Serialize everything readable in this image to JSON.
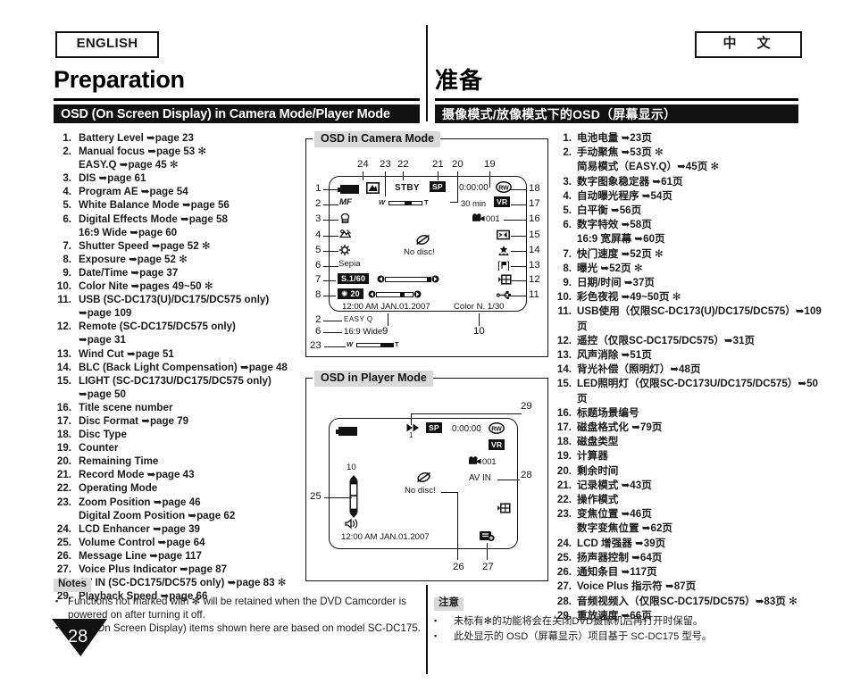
{
  "languages": {
    "english": "ENGLISH",
    "chinese": "中　文"
  },
  "chapter": {
    "en": "Preparation",
    "zh": "准备"
  },
  "section": {
    "en": "OSD (On Screen Display) in Camera Mode/Player Mode",
    "zh": "摄像模式/放像模式下的OSD（屏幕显示）"
  },
  "list_en": [
    {
      "num": "1.",
      "text": "Battery Level ➥page 23"
    },
    {
      "num": "2.",
      "text": "Manual focus ➥page 53 ✻",
      "sub": "EASY.Q ➥page 45 ✻"
    },
    {
      "num": "3.",
      "text": "DIS ➥page 61"
    },
    {
      "num": "4.",
      "text": "Program AE ➥page 54"
    },
    {
      "num": "5.",
      "text": "White Balance Mode ➥page 56"
    },
    {
      "num": "6.",
      "text": "Digital Effects Mode ➥page 58",
      "sub": "16:9 Wide ➥page 60"
    },
    {
      "num": "7.",
      "text": "Shutter Speed ➥page 52 ✻"
    },
    {
      "num": "8.",
      "text": "Exposure ➥page 52 ✻"
    },
    {
      "num": "9.",
      "text": "Date/Time ➥page 37"
    },
    {
      "num": "10.",
      "text": "Color Nite ➥pages 49~50 ✻"
    },
    {
      "num": "11.",
      "text": "USB (SC-DC173(U)/DC175/DC575 only)",
      "sub": "➥page 109"
    },
    {
      "num": "12.",
      "text": "Remote (SC-DC175/DC575 only)",
      "sub": "➥page 31"
    },
    {
      "num": "13.",
      "text": "Wind Cut ➥page 51"
    },
    {
      "num": "14.",
      "text": "BLC (Back Light Compensation) ➥page 48"
    },
    {
      "num": "15.",
      "text": "LIGHT (SC-DC173U/DC175/DC575 only)",
      "sub": "➥page 50"
    },
    {
      "num": "16.",
      "text": "Title scene number"
    },
    {
      "num": "17.",
      "text": "Disc Format ➥page 79"
    },
    {
      "num": "18.",
      "text": "Disc Type"
    },
    {
      "num": "19.",
      "text": "Counter"
    },
    {
      "num": "20.",
      "text": "Remaining Time"
    },
    {
      "num": "21.",
      "text": "Record Mode ➥page 43"
    },
    {
      "num": "22.",
      "text": "Operating Mode"
    },
    {
      "num": "23.",
      "text": "Zoom Position ➥page 46",
      "sub": "Digital Zoom Position ➥page 62"
    },
    {
      "num": "24.",
      "text": "LCD Enhancer ➥page 39"
    },
    {
      "num": "25.",
      "text": "Volume Control ➥page 64"
    },
    {
      "num": "26.",
      "text": "Message Line ➥page 117"
    },
    {
      "num": "27.",
      "text": "Voice Plus Indicator ➥page 87"
    },
    {
      "num": "28.",
      "text": "AV IN (SC-DC175/DC575 only) ➥page 83 ✻"
    },
    {
      "num": "29.",
      "text": "Playback Speed ➥page 66"
    }
  ],
  "list_zh": [
    {
      "num": "1.",
      "text": "电池电量 ➥23页"
    },
    {
      "num": "2.",
      "text": "手动聚焦 ➥53页 ✻",
      "sub": "简易模式（EASY.Q）➥45页 ✻"
    },
    {
      "num": "3.",
      "text": "数字图象稳定器 ➥61页"
    },
    {
      "num": "4.",
      "text": "自动曝光程序 ➥54页"
    },
    {
      "num": "5.",
      "text": "白平衡 ➥56页"
    },
    {
      "num": "6.",
      "text": "数字特效 ➥58页",
      "sub": "16:9 宽屏幕 ➥60页"
    },
    {
      "num": "7.",
      "text": "快门速度 ➥52页 ✻"
    },
    {
      "num": "8.",
      "text": "曝光 ➥52页 ✻"
    },
    {
      "num": "9.",
      "text": "日期/时间 ➥37页"
    },
    {
      "num": "10.",
      "text": "彩色夜视 ➥49~50页 ✻"
    },
    {
      "num": "11.",
      "text": "USB使用（仅限SC-DC173(U)/DC175/DC575）➥109页"
    },
    {
      "num": "12.",
      "text": "遥控（仅限SC-DC175/DC575）➥31页"
    },
    {
      "num": "13.",
      "text": "风声消除 ➥51页"
    },
    {
      "num": "14.",
      "text": "背光补偿（照明灯）➥48页"
    },
    {
      "num": "15.",
      "text": "LED照明灯（仅限SC-DC173U/DC175/DC575）➥50页"
    },
    {
      "num": "16.",
      "text": "标题场景编号"
    },
    {
      "num": "17.",
      "text": "磁盘格式化 ➥79页"
    },
    {
      "num": "18.",
      "text": "磁盘类型"
    },
    {
      "num": "19.",
      "text": "计算器"
    },
    {
      "num": "20.",
      "text": "剩余时间"
    },
    {
      "num": "21.",
      "text": "记录模式 ➥43页"
    },
    {
      "num": "22.",
      "text": "操作模式"
    },
    {
      "num": "23.",
      "text": "变焦位置 ➥46页",
      "sub": "数字变焦位置 ➥62页"
    },
    {
      "num": "24.",
      "text": "LCD 增强器 ➥39页"
    },
    {
      "num": "25.",
      "text": "扬声器控制 ➥64页"
    },
    {
      "num": "26.",
      "text": "通知条目 ➥117页"
    },
    {
      "num": "27.",
      "text": "Voice Plus 指示符 ➥87页"
    },
    {
      "num": "28.",
      "text": "音频视频入（仅限SC-DC175/DC575）➥83页 ✻"
    },
    {
      "num": "29.",
      "text": "重放速度 ➥66页"
    }
  ],
  "fig_camera": {
    "label": "OSD in Camera Mode",
    "osd": {
      "standby": "STBY",
      "record_mode": "SP",
      "counter": "0:00:00",
      "disc_type": "RW",
      "remaining": "30 min",
      "disc_format": "VR",
      "scene_number": "001",
      "manual_focus": "MF",
      "effect": "Sepia",
      "shutter": "S.1/60",
      "exposure": "20",
      "datetime": "12:00 AM JAN.01.2007",
      "color_nite": "Color N. 1/30",
      "no_disc": "No disc!",
      "easyq": "EASY Q",
      "wide": "16:9 Wide"
    },
    "callouts_left": [
      "1",
      "2",
      "3",
      "4",
      "5",
      "6",
      "7",
      "8"
    ],
    "callouts_right": [
      "18",
      "17",
      "16",
      "15",
      "14",
      "13",
      "12",
      "11"
    ],
    "callouts_top": [
      "24",
      "23",
      "22",
      "21",
      "20",
      "19"
    ],
    "callouts_bottom": [
      "9",
      "10"
    ],
    "callouts_extra": [
      "2",
      "6",
      "23"
    ]
  },
  "fig_player": {
    "label": "OSD in Player Mode",
    "osd": {
      "speed_index": "1",
      "record_mode": "SP",
      "counter": "0:00:00",
      "disc_type": "RW",
      "disc_format": "VR",
      "scene_number": "001",
      "av_in": "AV IN",
      "volume": "10",
      "no_disc": "No disc!",
      "datetime": "12:00 AM JAN.01.2007"
    },
    "callouts": [
      "29",
      "28",
      "25",
      "26",
      "27"
    ]
  },
  "notes": {
    "heading_en": "Notes",
    "heading_zh": "注意",
    "items_en": [
      "Functions not marked with ✻ will be retained when the DVD Camcorder is powered on after turning it off.",
      "OSD (On Screen Display) items shown here are based on model SC-DC175."
    ],
    "items_zh": [
      "未标有✻的功能将会在关闭DVD摄像机后再打开时保留。",
      "此处显示的 OSD（屏幕显示）项目基于 SC-DC175 型号。"
    ]
  },
  "page_number": "28",
  "colors": {
    "bar_bg": "#111111",
    "label_bg": "#d9d9d9",
    "text": "#1a1a1a"
  }
}
